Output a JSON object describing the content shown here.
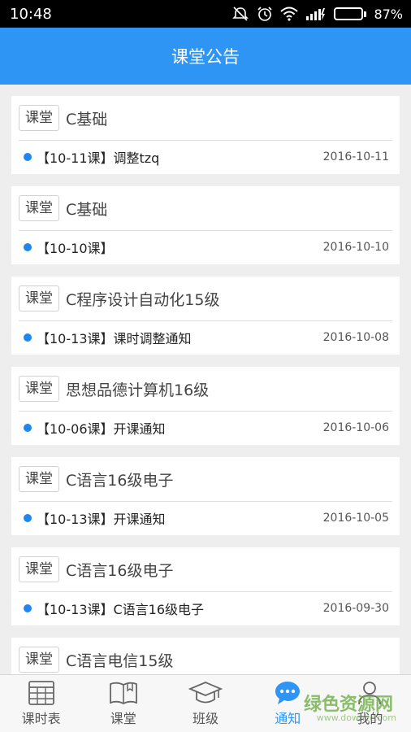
{
  "status": {
    "time": "10:48",
    "battery_text": "87%",
    "battery_level": 0.87,
    "battery_color": "#4cd964"
  },
  "header": {
    "title": "课堂公告",
    "color": "#2f95f5"
  },
  "cards": [
    {
      "tag": "课堂",
      "course": "C基础",
      "notice": "【10-11课】调整tzq",
      "date": "2016-10-11"
    },
    {
      "tag": "课堂",
      "course": "C基础",
      "notice": "【10-10课】",
      "date": "2016-10-10"
    },
    {
      "tag": "课堂",
      "course": "C程序设计自动化15级",
      "notice": "【10-13课】课时调整通知",
      "date": "2016-10-08"
    },
    {
      "tag": "课堂",
      "course": "思想品德计算机16级",
      "notice": "【10-06课】开课通知",
      "date": "2016-10-06"
    },
    {
      "tag": "课堂",
      "course": "C语言16级电子",
      "notice": "【10-13课】开课通知",
      "date": "2016-10-05"
    },
    {
      "tag": "课堂",
      "course": "C语言16级电子",
      "notice": "【10-13课】C语言16级电子",
      "date": "2016-09-30"
    },
    {
      "tag": "课堂",
      "course": "C语言电信15级",
      "notice": "",
      "date": ""
    }
  ],
  "tabs": [
    {
      "label": "课时表",
      "icon": "timetable-icon"
    },
    {
      "label": "课堂",
      "icon": "book-icon"
    },
    {
      "label": "班级",
      "icon": "graduation-cap-icon"
    },
    {
      "label": "通知",
      "icon": "chat-bubble-icon",
      "active": true
    },
    {
      "label": "我的",
      "icon": "user-icon"
    }
  ],
  "watermark": {
    "text": "绿色资源网",
    "url": "www.downcc.com"
  }
}
